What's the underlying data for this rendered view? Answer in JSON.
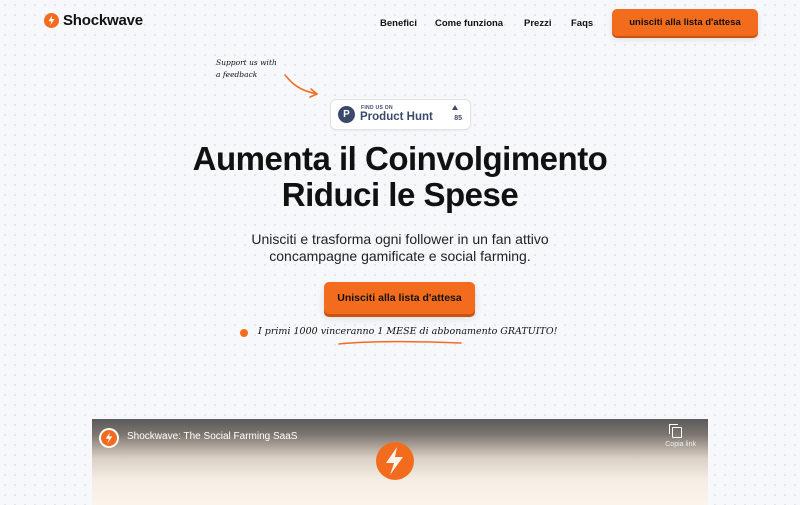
{
  "header": {
    "brand": "Shockwave",
    "nav": [
      "Benefici",
      "Come funziona",
      "Prezzi",
      "Faqs"
    ],
    "cta": "unisciti alla lista d'attesa"
  },
  "note": {
    "line1": "Support us with",
    "line2": "a feedback"
  },
  "product_hunt": {
    "small": "FIND US ON",
    "big": "Product Hunt",
    "count": "85"
  },
  "hero": {
    "title_line1": "Aumenta il Coinvolgimento",
    "title_line2": "Riduci le Spese",
    "subtitle_line1": "Unisciti e trasforma ogni follower in un fan attivo",
    "subtitle_line2": "concampagne gamificate e social farming.",
    "cta": "Unisciti alla lista d'attesa",
    "promo_before": "I primi 1000 vinceranno ",
    "promo_highlight": "1 MESE",
    "promo_after": " di abbonamento GRATUITO!"
  },
  "video": {
    "title": "Shockwave: The Social Farming SaaS",
    "copy_label": "Copia link"
  },
  "colors": {
    "accent": "#f36c1e",
    "ph": "#3b4a6b"
  }
}
